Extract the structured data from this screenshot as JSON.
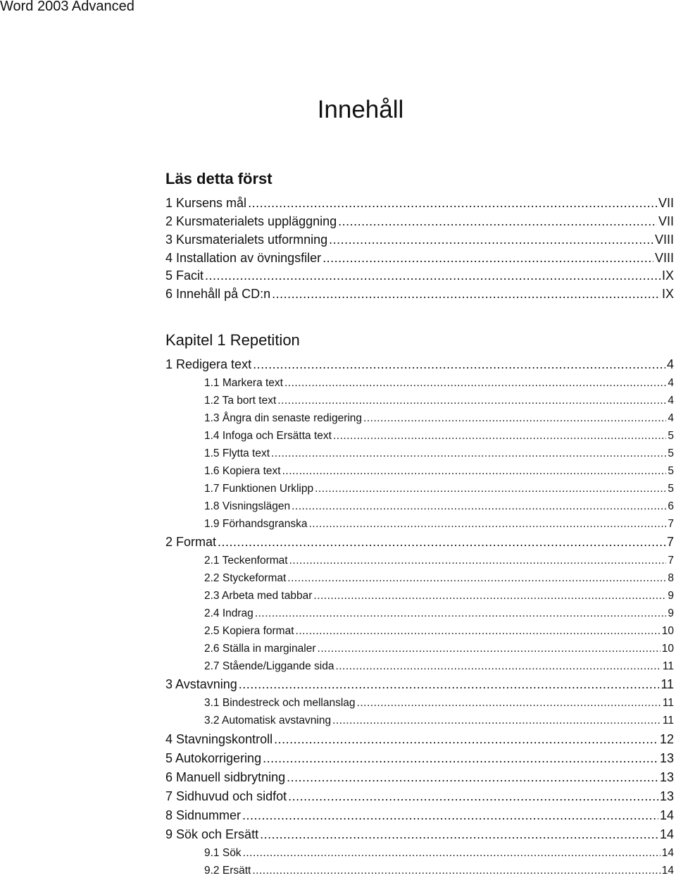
{
  "header": {
    "title": "Word 2003 Advanced"
  },
  "page_title": "Innehåll",
  "sections": [
    {
      "heading": "Läs detta först",
      "bold": true,
      "entries": [
        {
          "label": "1 Kursens mål",
          "page": "VII",
          "level": 1
        },
        {
          "label": "2 Kursmaterialets uppläggning",
          "page": "VII",
          "level": 1
        },
        {
          "label": "3 Kursmaterialets utformning",
          "page": "VIII",
          "level": 1
        },
        {
          "label": "4 Installation av övningsfiler",
          "page": "VIII",
          "level": 1
        },
        {
          "label": "5 Facit",
          "page": "IX",
          "level": 1
        },
        {
          "label": "6 Innehåll på CD:n",
          "page": "IX",
          "level": 1
        }
      ]
    },
    {
      "heading": "Kapitel 1 Repetition",
      "bold": false,
      "entries": [
        {
          "label": "1 Redigera text",
          "page": "4",
          "level": 1
        },
        {
          "label": "1.1 Markera text",
          "page": "4",
          "level": 2
        },
        {
          "label": "1.2 Ta bort text",
          "page": "4",
          "level": 2
        },
        {
          "label": "1.3 Ångra din senaste redigering",
          "page": "4",
          "level": 2
        },
        {
          "label": "1.4 Infoga och Ersätta text",
          "page": "5",
          "level": 2
        },
        {
          "label": "1.5 Flytta text",
          "page": "5",
          "level": 2
        },
        {
          "label": "1.6 Kopiera text",
          "page": "5",
          "level": 2
        },
        {
          "label": "1.7 Funktionen Urklipp",
          "page": "5",
          "level": 2
        },
        {
          "label": "1.8 Visningslägen",
          "page": "6",
          "level": 2
        },
        {
          "label": "1.9 Förhandsgranska",
          "page": "7",
          "level": 2
        },
        {
          "label": "2 Format",
          "page": "7",
          "level": 1
        },
        {
          "label": "2.1 Teckenformat",
          "page": "7",
          "level": 2
        },
        {
          "label": "2.2 Styckeformat",
          "page": "8",
          "level": 2
        },
        {
          "label": "2.3 Arbeta med tabbar",
          "page": "9",
          "level": 2
        },
        {
          "label": "2.4 Indrag",
          "page": "9",
          "level": 2
        },
        {
          "label": "2.5 Kopiera format",
          "page": "10",
          "level": 2
        },
        {
          "label": "2.6 Ställa in marginaler",
          "page": "10",
          "level": 2
        },
        {
          "label": "2.7 Stående/Liggande sida",
          "page": "11",
          "level": 2
        },
        {
          "label": "3 Avstavning",
          "page": "11",
          "level": 1
        },
        {
          "label": "3.1 Bindestreck och mellanslag",
          "page": "11",
          "level": 2
        },
        {
          "label": "3.2 Automatisk avstavning",
          "page": "11",
          "level": 2
        },
        {
          "label": "4 Stavningskontroll",
          "page": "12",
          "level": 1
        },
        {
          "label": "5 Autokorrigering",
          "page": "13",
          "level": 1
        },
        {
          "label": "6 Manuell sidbrytning",
          "page": "13",
          "level": 1
        },
        {
          "label": "7 Sidhuvud och sidfot",
          "page": "13",
          "level": 1
        },
        {
          "label": "8 Sidnummer",
          "page": "14",
          "level": 1
        },
        {
          "label": "9 Sök och Ersätt",
          "page": "14",
          "level": 1
        },
        {
          "label": "9.1 Sök",
          "page": "14",
          "level": 2
        },
        {
          "label": "9.2 Ersätt",
          "page": "14",
          "level": 2
        }
      ]
    }
  ]
}
